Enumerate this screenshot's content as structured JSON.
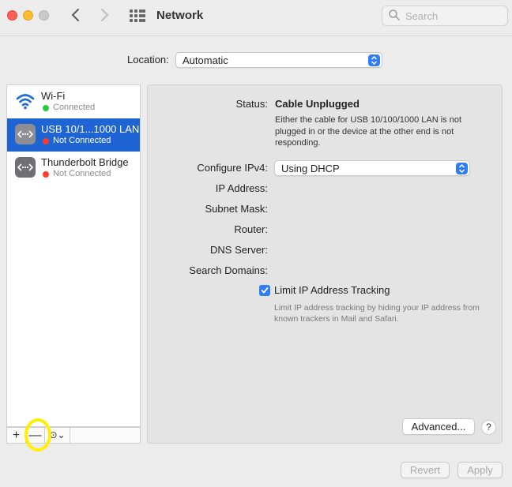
{
  "window": {
    "title": "Network",
    "search_placeholder": "Search"
  },
  "location": {
    "label": "Location:",
    "value": "Automatic"
  },
  "services": [
    {
      "name": "Wi-Fi",
      "status": "Connected",
      "status_color": "#28c840",
      "selected": false,
      "icon": "wifi-icon"
    },
    {
      "name": "USB 10/1...1000 LAN",
      "status": "Not Connected",
      "status_color": "#ff3b30",
      "selected": true,
      "icon": "ethernet-icon"
    },
    {
      "name": "Thunderbolt Bridge",
      "status": "Not Connected",
      "status_color": "#ff3b30",
      "selected": false,
      "icon": "ethernet-icon"
    }
  ],
  "sidebar_toolbar": {
    "add": "+",
    "remove": "—",
    "action": "⊙⌄"
  },
  "detail": {
    "status_label": "Status:",
    "status_value": "Cable Unplugged",
    "status_description": "Either the cable for USB 10/100/1000 LAN is not plugged in or the device at the other end is not responding.",
    "configure_label": "Configure IPv4:",
    "configure_value": "Using DHCP",
    "ip_label": "IP Address:",
    "subnet_label": "Subnet Mask:",
    "router_label": "Router:",
    "dns_label": "DNS Server:",
    "search_domains_label": "Search Domains:",
    "limit_tracking_label": "Limit IP Address Tracking",
    "limit_tracking_checked": true,
    "limit_tracking_description": "Limit IP address tracking by hiding your IP address from known trackers in Mail and Safari.",
    "advanced_label": "Advanced...",
    "help_label": "?"
  },
  "footer": {
    "revert_label": "Revert",
    "apply_label": "Apply"
  },
  "colors": {
    "accent": "#2f7df6",
    "selection": "#1e64d2",
    "highlight_ring": "#ffef00"
  }
}
